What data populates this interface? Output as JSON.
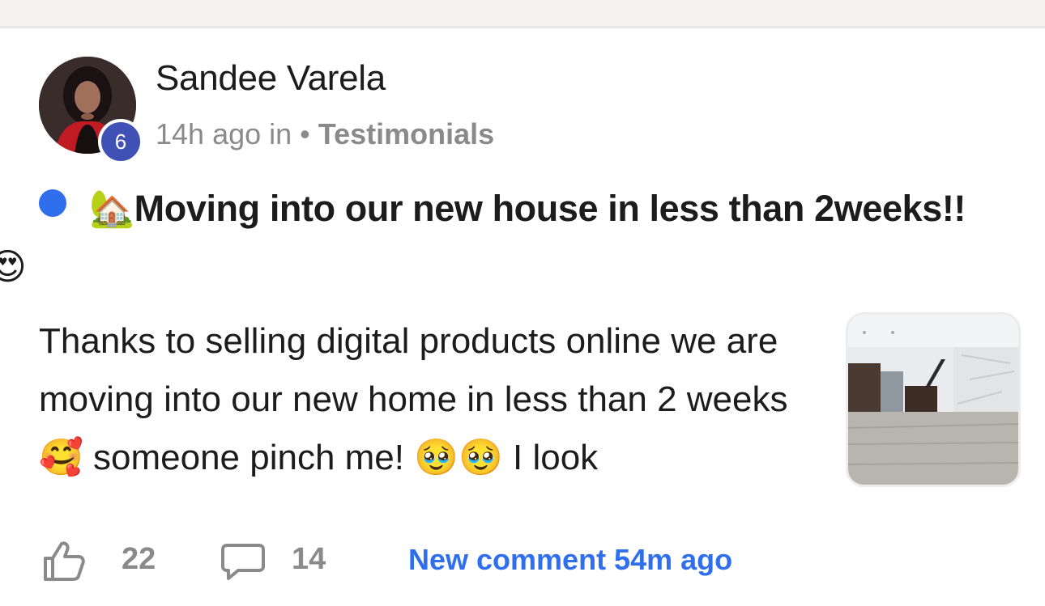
{
  "post": {
    "author": {
      "name": "Sandee Varela",
      "level": "6"
    },
    "meta": {
      "time": "14h ago in",
      "separator": "•",
      "category": "Testimonials"
    },
    "title_emoji": "🏡",
    "title": "Moving into our new house in less than 2weeks!!",
    "title_trailing_emoji": "😍",
    "body": "Thanks to selling digital products online we are moving into our new home in less than 2 weeks 🥰 someone pinch me! 🥹🥹 I look",
    "thumbnail_icon": "house-interior-photo"
  },
  "footer": {
    "like_icon": "thumbs-up-icon",
    "likes": "22",
    "comment_icon": "comment-bubble-icon",
    "comments": "14",
    "new_comment": "New comment 54m ago"
  },
  "colors": {
    "accent": "#2f6fed",
    "badge": "#3f51b5",
    "muted": "#8a8a8a",
    "text": "#1c1c1c"
  }
}
